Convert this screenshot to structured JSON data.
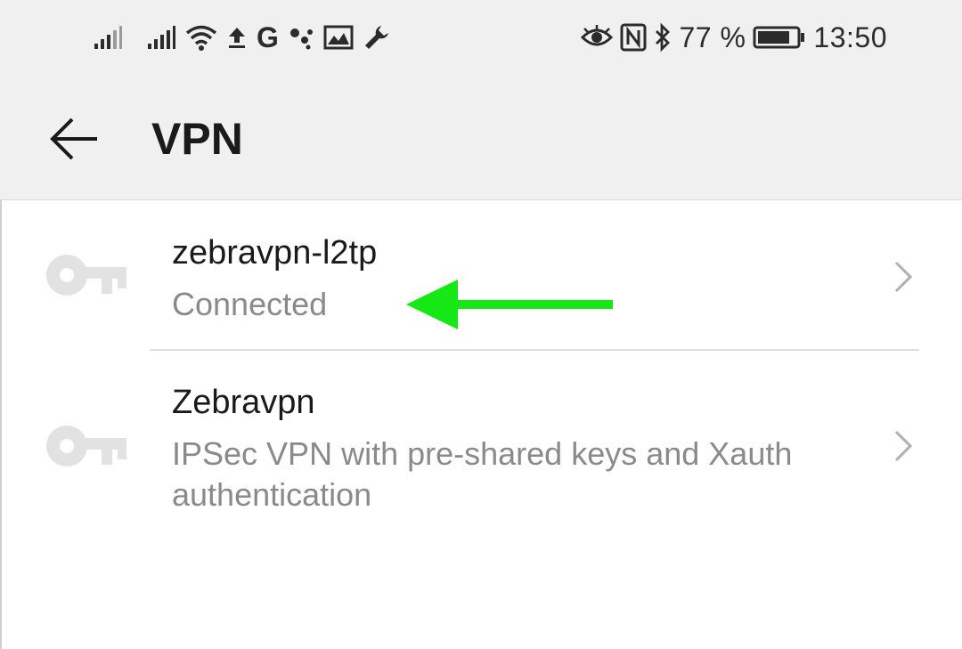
{
  "status_bar": {
    "battery_text": "77 %",
    "time": "13:50",
    "google_letter": "G",
    "icons_left": [
      "signal-weak-icon",
      "signal-icon",
      "wifi-icon",
      "upload-icon",
      "google-icon",
      "assistant-dots-icon",
      "gallery-icon",
      "wrench-icon"
    ],
    "icons_right": [
      "eye-icon",
      "nfc-icon",
      "bluetooth-icon",
      "battery-icon"
    ]
  },
  "header": {
    "title": "VPN",
    "back_icon": "back-arrow-icon"
  },
  "vpn_list": [
    {
      "name": "zebravpn-l2tp",
      "status": "Connected",
      "icon": "key-icon"
    },
    {
      "name": "Zebravpn",
      "status_line1": "IPSec VPN with pre-shared keys and Xauth",
      "status_line2": "authentication",
      "icon": "key-icon"
    }
  ],
  "colors": {
    "header_bg": "#f0f0f0",
    "annotation_arrow": "#16e816",
    "secondary_text": "#8a8a8a",
    "icon_gray": "#e2e2e2"
  }
}
